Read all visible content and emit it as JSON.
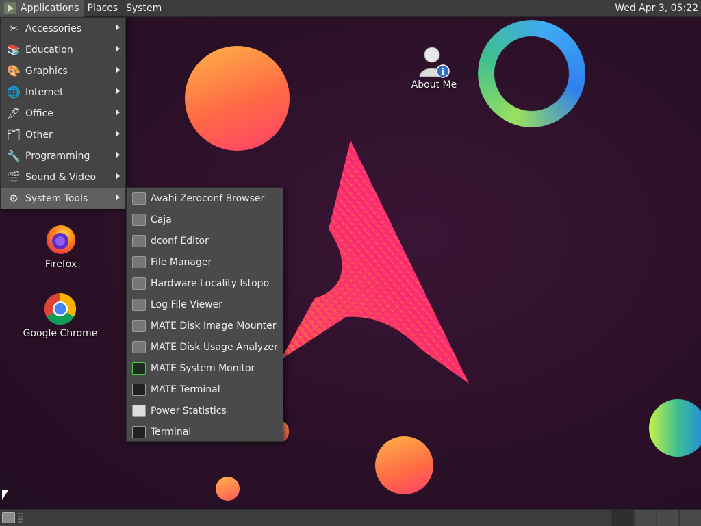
{
  "top_panel": {
    "menus": [
      "Applications",
      "Places",
      "System"
    ],
    "clock": "Wed Apr  3, 05:22"
  },
  "app_menu": {
    "items": [
      {
        "label": "Accessories",
        "icon": "accessories-icon"
      },
      {
        "label": "Education",
        "icon": "education-icon"
      },
      {
        "label": "Graphics",
        "icon": "graphics-icon"
      },
      {
        "label": "Internet",
        "icon": "internet-icon"
      },
      {
        "label": "Office",
        "icon": "office-icon"
      },
      {
        "label": "Other",
        "icon": "other-icon"
      },
      {
        "label": "Programming",
        "icon": "programming-icon"
      },
      {
        "label": "Sound & Video",
        "icon": "sound-video-icon"
      },
      {
        "label": "System Tools",
        "icon": "system-tools-icon"
      }
    ],
    "selected": "System Tools"
  },
  "system_tools_submenu": {
    "items": [
      "Avahi Zeroconf Browser",
      "Caja",
      "dconf Editor",
      "File Manager",
      "Hardware Locality lstopo",
      "Log File Viewer",
      "MATE Disk Image Mounter",
      "MATE Disk Usage Analyzer",
      "MATE System Monitor",
      "MATE Terminal",
      "Power Statistics",
      "Terminal"
    ]
  },
  "desktop_icons": {
    "about_me": "About Me",
    "firefox": "Firefox",
    "chrome": "Google Chrome"
  }
}
